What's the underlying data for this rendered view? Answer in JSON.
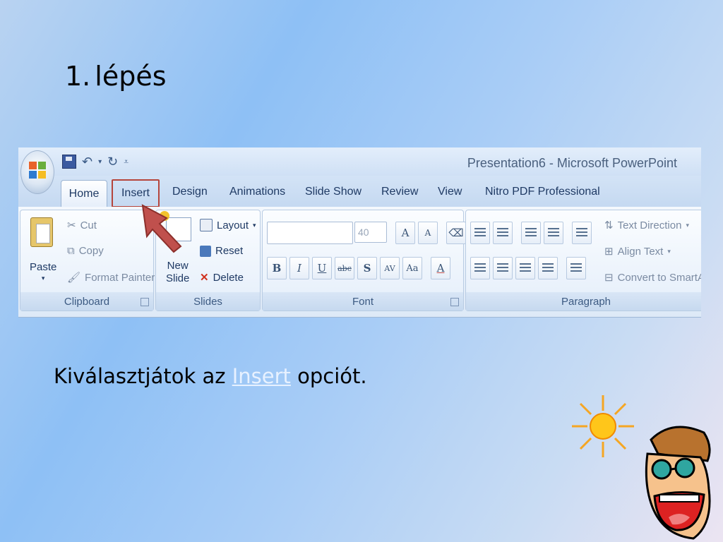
{
  "slide": {
    "title_number": "1.",
    "title": "lépés",
    "body_before": "Kiválasztjátok az ",
    "body_link": "Insert",
    "body_after": " opciót."
  },
  "ribbon": {
    "window_title": "Presentation6 - Microsoft PowerPoint",
    "tabs": [
      "Home",
      "Insert",
      "Design",
      "Animations",
      "Slide Show",
      "Review",
      "View",
      "Nitro PDF Professional"
    ],
    "highlighted_tab": "Insert",
    "clipboard": {
      "label": "Clipboard",
      "paste": "Paste",
      "cut": "Cut",
      "copy": "Copy",
      "format_painter": "Format Painter"
    },
    "slides": {
      "label": "Slides",
      "new_slide_line1": "New",
      "new_slide_line2": "Slide",
      "layout": "Layout",
      "reset": "Reset",
      "delete": "Delete"
    },
    "font": {
      "label": "Font",
      "size": "40"
    },
    "paragraph": {
      "label": "Paragraph",
      "text_direction": "Text Direction",
      "align_text": "Align Text",
      "convert": "Convert to SmartA"
    }
  },
  "colors": {
    "highlight_border": "#b5453c",
    "arrow": "#c0504d",
    "link": "#e7f1ff"
  }
}
